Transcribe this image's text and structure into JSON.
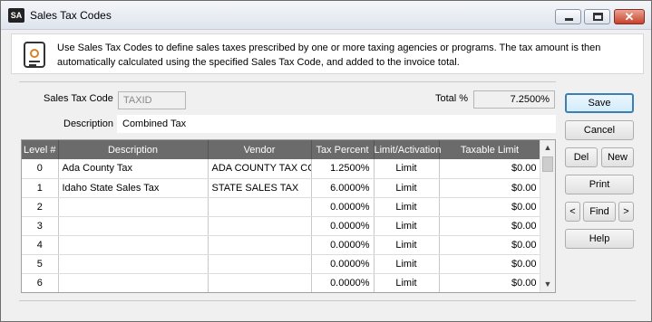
{
  "window": {
    "title": "Sales Tax Codes",
    "app_icon_label": "SA"
  },
  "info": {
    "text": "Use Sales Tax Codes to define sales taxes prescribed by one or more taxing agencies or programs. The tax amount is then automatically calculated using the specified Sales Tax Code, and added to the invoice total."
  },
  "form": {
    "sales_tax_code_label": "Sales Tax Code",
    "sales_tax_code_value": "TAXID",
    "total_pct_label": "Total %",
    "total_pct_value": "7.2500%",
    "description_label": "Description",
    "description_value": "Combined Tax"
  },
  "grid": {
    "columns": [
      "Level #",
      "Description",
      "Vendor",
      "Tax Percent",
      "Limit/Activation",
      "Taxable Limit"
    ],
    "rows": [
      {
        "level": "0",
        "description": "Ada County Tax",
        "vendor": "ADA COUNTY TAX CC",
        "tax_percent": "1.2500%",
        "limit": "Limit",
        "taxable_limit": "$0.00"
      },
      {
        "level": "1",
        "description": "Idaho State Sales Tax",
        "vendor": "STATE SALES TAX",
        "tax_percent": "6.0000%",
        "limit": "Limit",
        "taxable_limit": "$0.00"
      },
      {
        "level": "2",
        "description": "",
        "vendor": "",
        "tax_percent": "0.0000%",
        "limit": "Limit",
        "taxable_limit": "$0.00"
      },
      {
        "level": "3",
        "description": "",
        "vendor": "",
        "tax_percent": "0.0000%",
        "limit": "Limit",
        "taxable_limit": "$0.00"
      },
      {
        "level": "4",
        "description": "",
        "vendor": "",
        "tax_percent": "0.0000%",
        "limit": "Limit",
        "taxable_limit": "$0.00"
      },
      {
        "level": "5",
        "description": "",
        "vendor": "",
        "tax_percent": "0.0000%",
        "limit": "Limit",
        "taxable_limit": "$0.00"
      },
      {
        "level": "6",
        "description": "",
        "vendor": "",
        "tax_percent": "0.0000%",
        "limit": "Limit",
        "taxable_limit": "$0.00"
      }
    ]
  },
  "buttons": {
    "save": "Save",
    "cancel": "Cancel",
    "del": "Del",
    "new": "New",
    "print": "Print",
    "prev": "<",
    "find": "Find",
    "next": ">",
    "help": "Help"
  },
  "icons": {
    "app": "sa-app-icon",
    "info": "document-seal-icon",
    "minimize": "minimize-icon",
    "maximize": "maximize-icon",
    "close": "close-icon",
    "scroll_up": "chevron-up-icon",
    "scroll_down": "chevron-down-icon"
  },
  "colors": {
    "grid_header": "#6b6b6b",
    "close_button": "#c8402a",
    "default_button_border": "#3c7fb1"
  }
}
